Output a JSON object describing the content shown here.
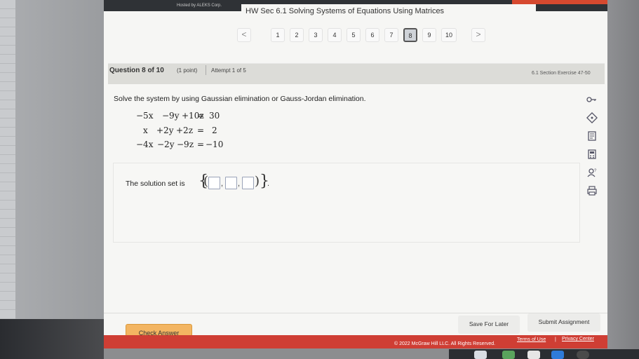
{
  "header": {
    "hosted_by": "Hosted by ALEKS Corp.",
    "assignment_title": "HW Sec 6.1 Solving Systems of Equations Using Matrices"
  },
  "pager": {
    "prev": "<",
    "next": ">",
    "pages": [
      "1",
      "2",
      "3",
      "4",
      "5",
      "6",
      "7",
      "8",
      "9",
      "10"
    ],
    "current": "8"
  },
  "question": {
    "number": "Question 8 of 10",
    "points": "(1 point)",
    "attempt": "Attempt 1 of 5",
    "section": "6.1 Section Exercise 47-50",
    "prompt": "Solve the system by using Gaussian elimination or Gauss-Jordan elimination."
  },
  "equations": [
    [
      "−5x",
      "−9y",
      "+10z",
      "=",
      "30"
    ],
    [
      "x",
      "+2y",
      "+2z",
      "=",
      "2"
    ],
    [
      "−4x",
      "−2y",
      "−9z",
      "=",
      "−10"
    ]
  ],
  "answer": {
    "label": "The solution set is",
    "open_brace": "{",
    "open_paren": "(",
    "comma": ",",
    "close_paren": ")",
    "close_brace": "}",
    "period": ".",
    "x_value": "",
    "y_value": "",
    "z_value": ""
  },
  "tools": [
    "key-icon",
    "hint-icon",
    "notes-icon",
    "calculator-icon",
    "help-person-icon",
    "print-icon"
  ],
  "footer": {
    "check_answer": "Check Answer",
    "save_for_later": "Save For Later",
    "submit_assignment": "Submit Assignment",
    "copyright": "© 2022 McGraw Hill LLC. All Rights Reserved.",
    "terms": "Terms of Use",
    "separator": "|",
    "privacy": "Privacy Center"
  },
  "colors": {
    "check_button": "#f3b562",
    "footer_bar": "#cf3e34",
    "top_accent": "#d6492f"
  }
}
